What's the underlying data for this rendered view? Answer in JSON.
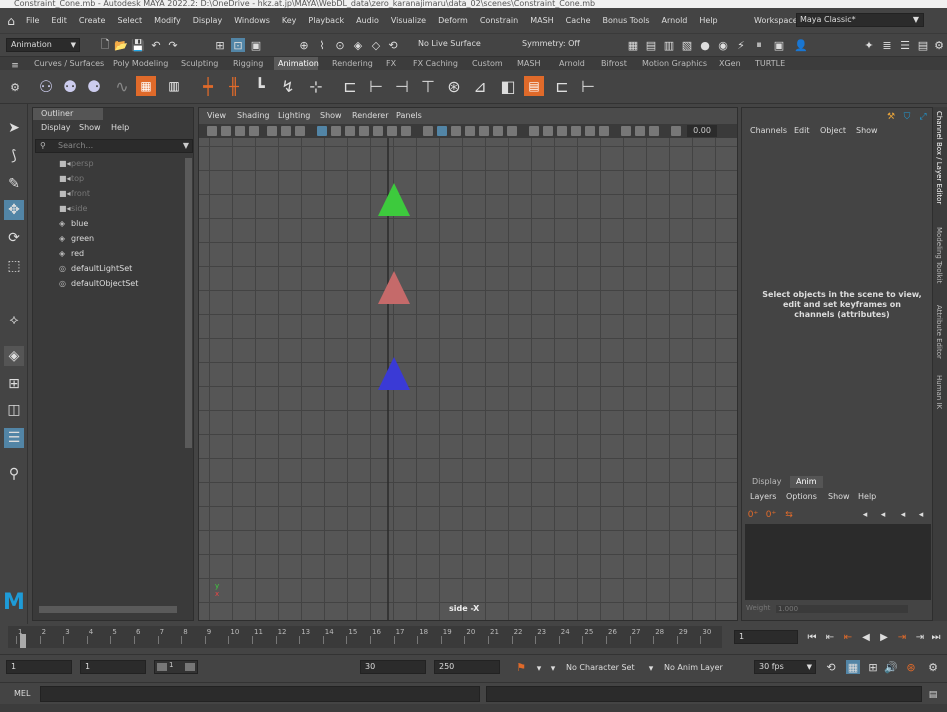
{
  "window": {
    "title": "Constraint_Cone.mb - Autodesk MAYA 2022.2: D:\\OneDrive - hkz.at.jp\\MAYA\\WebDL_data\\zero_karanajimaru\\data_02\\scenes\\Constraint_Cone.mb"
  },
  "menubar": {
    "items": [
      "File",
      "Edit",
      "Create",
      "Select",
      "Modify",
      "Display",
      "Windows",
      "Key",
      "Playback",
      "Audio",
      "Visualize",
      "Deform",
      "Constrain",
      "MASH",
      "Cache",
      "Bonus Tools",
      "Arnold",
      "Help"
    ],
    "workspace_label": "Workspace:",
    "workspace_value": "Maya Classic*"
  },
  "status_line": {
    "menu_set": "Animation",
    "live_surface": "No Live Surface",
    "symmetry": "Symmetry: Off"
  },
  "shelf": {
    "tabs": [
      "Curves / Surfaces",
      "Poly Modeling",
      "Sculpting",
      "Rigging",
      "Animation",
      "Rendering",
      "FX",
      "FX Caching",
      "Custom",
      "MASH",
      "Arnold",
      "Bifrost",
      "Motion Graphics",
      "XGen",
      "TURTLE"
    ],
    "active_tab": "Animation"
  },
  "outliner": {
    "title": "Outliner",
    "menu": [
      "Display",
      "Show",
      "Help"
    ],
    "search_placeholder": "Search...",
    "items": [
      {
        "label": "persp",
        "icon": "camera-icon",
        "dim": true
      },
      {
        "label": "top",
        "icon": "camera-icon",
        "dim": true
      },
      {
        "label": "front",
        "icon": "camera-icon",
        "dim": true
      },
      {
        "label": "side",
        "icon": "camera-icon",
        "dim": true
      },
      {
        "label": "blue",
        "icon": "transform-icon",
        "dim": false
      },
      {
        "label": "green",
        "icon": "transform-icon",
        "dim": false
      },
      {
        "label": "red",
        "icon": "transform-icon",
        "dim": false
      },
      {
        "label": "defaultLightSet",
        "icon": "set-icon",
        "dim": false
      },
      {
        "label": "defaultObjectSet",
        "icon": "set-icon",
        "dim": false
      }
    ]
  },
  "viewport": {
    "menu": [
      "View",
      "Shading",
      "Lighting",
      "Show",
      "Renderer",
      "Panels"
    ],
    "exposure_value": "0.00",
    "camera_label": "side -X",
    "axis_y": "y",
    "axis_x": "x",
    "objects": [
      {
        "name": "green",
        "color": "#3dca3d"
      },
      {
        "name": "red",
        "color": "#c56a6a"
      },
      {
        "name": "blue",
        "color": "#3a3ad6"
      }
    ]
  },
  "channel_box": {
    "menu": [
      "Channels",
      "Edit",
      "Object",
      "Show"
    ],
    "message": "Select objects in the scene to view, edit and set keyframes on channels (attributes)",
    "tabs": [
      "Display",
      "Anim"
    ],
    "active_tab": "Anim",
    "layers_menu": [
      "Layers",
      "Options",
      "Show",
      "Help"
    ],
    "weight_label": "Weight",
    "weight_value": "1.000"
  },
  "side_tabs": [
    "Channel Box / Layer Editor",
    "Modeling Toolkit",
    "Attribute Editor",
    "Human IK"
  ],
  "timeline": {
    "ticks": [
      "1",
      "2",
      "3",
      "4",
      "5",
      "6",
      "7",
      "8",
      "9",
      "10",
      "11",
      "12",
      "13",
      "14",
      "15",
      "16",
      "17",
      "18",
      "19",
      "20",
      "21",
      "22",
      "23",
      "24",
      "25",
      "26",
      "27",
      "28",
      "29",
      "30"
    ],
    "current_frame": "1"
  },
  "range": {
    "start": "1",
    "playback_start": "1",
    "slider_value": "1",
    "playback_end": "30",
    "end": "250",
    "character_set": "No Character Set",
    "anim_layer": "No Anim Layer",
    "fps": "30 fps"
  },
  "command_line": {
    "label": "MEL"
  },
  "colors": {
    "accent": "#5285a6",
    "logo": "#1e9bd7"
  }
}
